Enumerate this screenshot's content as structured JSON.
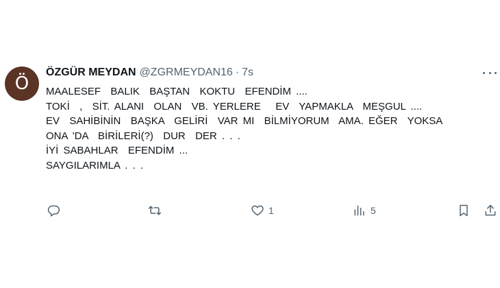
{
  "tweet": {
    "avatar_initial": "Ö",
    "display_name": "ÖZGÜR MEYDAN",
    "handle": "@ZGRMEYDAN16",
    "separator": "·",
    "time": "7s",
    "lines": [
      "MAALESEF  BALIK  BAŞTAN  KOKTU  EFENDİM ....",
      "TOKİ  ,  SİT. ALANI  OLAN  VB. YERLERE   EV  YAPMAKLA  MEŞGUL ....",
      "EV  SAHİBİNİN  BAŞKA  GELİRİ  VAR MI  BİLMİYORUM  AMA. EĞER  YOKSA",
      "ONA 'DA  BİRİLERİ(?)  DUR  DER . . .",
      "İYİ SABAHLAR  EFENDİM ...",
      "SAYGILARIMLA . . ."
    ]
  },
  "actions": {
    "reply": {
      "icon": "reply-icon",
      "count": ""
    },
    "retweet": {
      "icon": "retweet-icon",
      "count": ""
    },
    "like": {
      "icon": "heart-icon",
      "count": "1"
    },
    "views": {
      "icon": "views-icon",
      "count": "5"
    },
    "bookmark": {
      "icon": "bookmark-icon"
    },
    "share": {
      "icon": "share-icon"
    }
  },
  "colors": {
    "avatar_bg": "#5b3426",
    "secondary_text": "#536471",
    "primary_text": "#0f1419"
  }
}
